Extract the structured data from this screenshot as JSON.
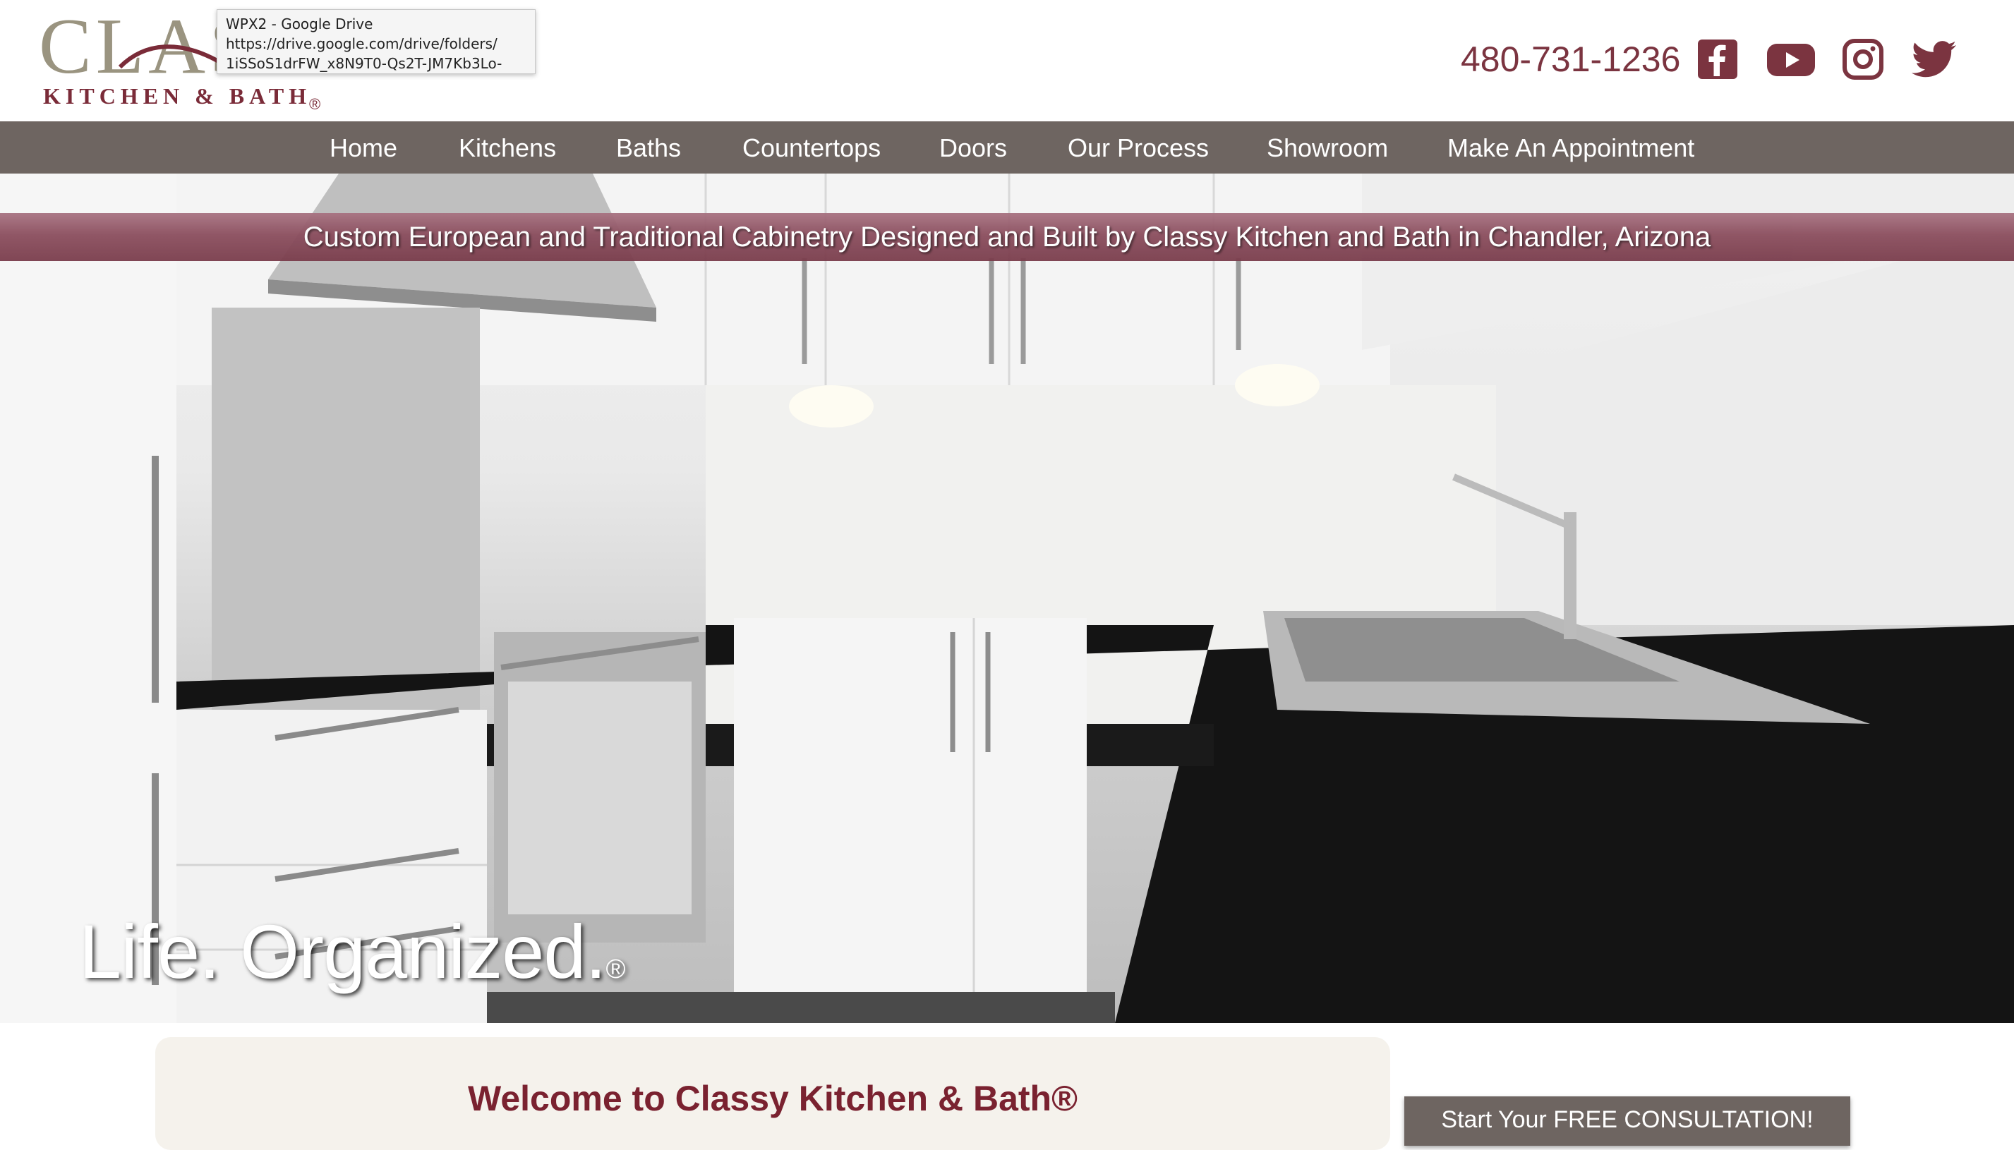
{
  "header": {
    "logo": {
      "main_text": "CLAS",
      "sub_text": "KITCHEN & BATH",
      "reg_mark": "®"
    },
    "tooltip": {
      "title": "WPX2 - Google Drive",
      "url_line1": "https://drive.google.com/drive/folders/",
      "url_line2": "1iSSoS1drFW_x8N9T0-Qs2T-JM7Kb3Lo-"
    },
    "phone": "480-731-1236",
    "social": [
      "facebook-icon",
      "youtube-icon",
      "instagram-icon",
      "twitter-icon"
    ]
  },
  "nav": {
    "items": [
      {
        "label": "Home"
      },
      {
        "label": "Kitchens"
      },
      {
        "label": "Baths"
      },
      {
        "label": "Countertops"
      },
      {
        "label": "Doors"
      },
      {
        "label": "Our Process"
      },
      {
        "label": "Showroom"
      },
      {
        "label": "Make An Appointment"
      }
    ]
  },
  "hero": {
    "banner": "Custom European and Traditional Cabinetry Designed and Built by Classy Kitchen and Bath in Chandler, Arizona",
    "tagline": "Life. Organized.",
    "tagline_reg": "®"
  },
  "welcome": {
    "title": "Welcome to Classy Kitchen & Bath®"
  },
  "cta": {
    "label": "Start Your FREE CONSULTATION!"
  },
  "colors": {
    "brand": "#7a3d4c",
    "nav_bg": "#6e6561",
    "welcome_bg": "#f5f2ec",
    "welcome_title": "#7a2230"
  }
}
